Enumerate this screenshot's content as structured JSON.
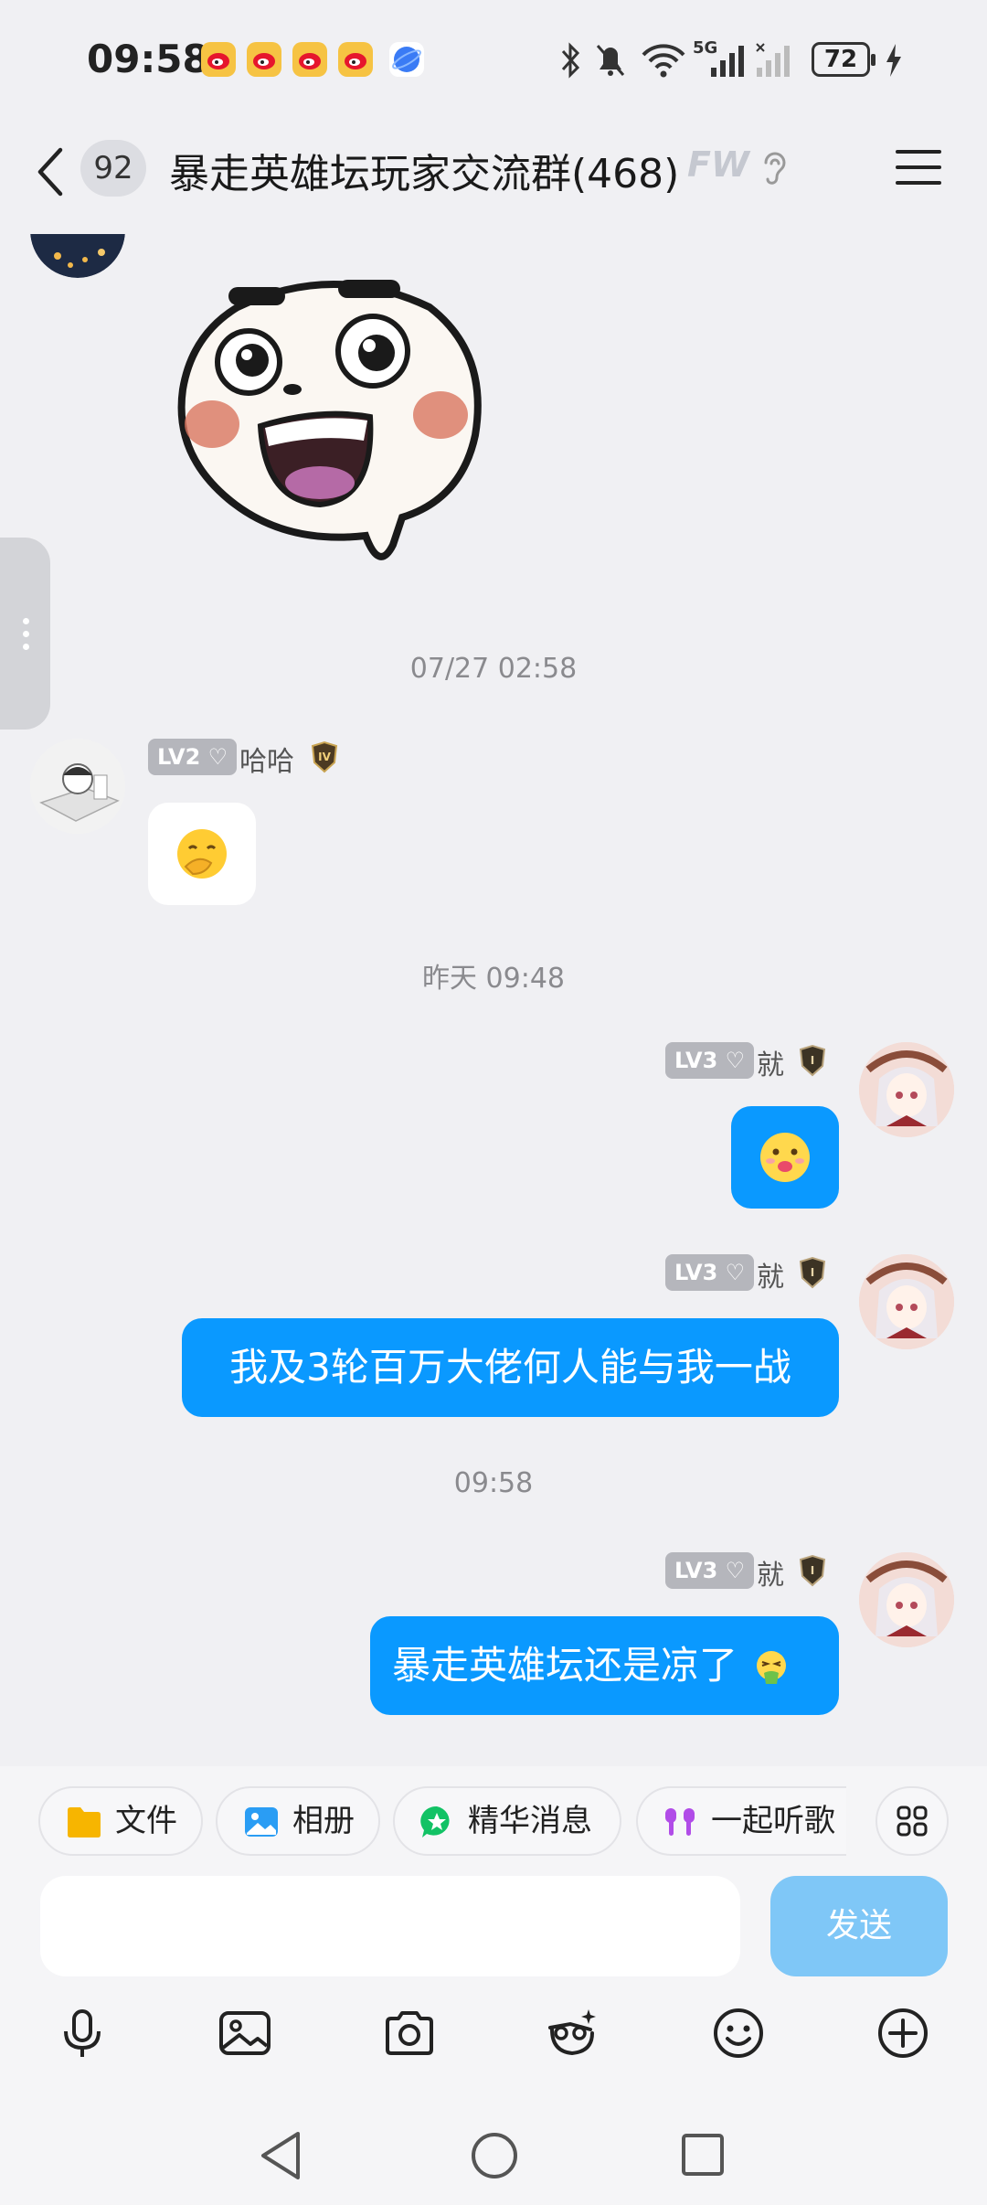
{
  "status_bar": {
    "time": "09:58",
    "battery": "72",
    "network": "5G"
  },
  "header": {
    "unread_count": "92",
    "title": "暴走英雄坛玩家交流群(468)",
    "badge": "FW"
  },
  "messages": {
    "timestamp_1": "07/27 02:58",
    "timestamp_2": "昨天 09:48",
    "timestamp_3": "09:58",
    "haha": {
      "level": "LV2 ♡",
      "name": "哈哈"
    },
    "jiu_1": {
      "level": "LV3 ♡",
      "name": "就"
    },
    "jiu_2": {
      "level": "LV3 ♡",
      "name": "就",
      "text": "我及3轮百万大佬何人能与我一战"
    },
    "jiu_3": {
      "level": "LV3 ♡",
      "name": "就",
      "text": "暴走英雄坛还是凉了"
    }
  },
  "quick_actions": {
    "file": "文件",
    "album": "相册",
    "essence": "精华消息",
    "music": "一起听歌"
  },
  "composer": {
    "send_label": "发送",
    "input_value": ""
  }
}
